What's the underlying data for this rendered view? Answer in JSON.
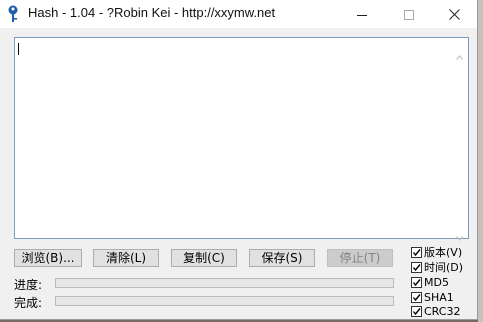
{
  "window": {
    "title": "Hash - 1.04 - ?Robin Kei - http://xxymw.net",
    "app_icon": "pin-key-icon",
    "controls": {
      "minimize_icon": "minimize-icon",
      "maximize_icon": "maximize-icon",
      "close_icon": "close-icon"
    }
  },
  "output": {
    "text": ""
  },
  "buttons": {
    "browse": "浏览(B)...",
    "clear": "清除(L)",
    "copy": "复制(C)",
    "save": "保存(S)",
    "stop": "停止(T)"
  },
  "progress": {
    "progress_label": "进度:",
    "progress_value": 0,
    "complete_label": "完成:",
    "complete_value": 0
  },
  "options": [
    {
      "label": "版本(V)",
      "checked": true
    },
    {
      "label": "时间(D)",
      "checked": true
    },
    {
      "label": "MD5",
      "checked": true
    },
    {
      "label": "SHA1",
      "checked": true
    },
    {
      "label": "CRC32",
      "checked": true
    }
  ],
  "colors": {
    "progress_fill": "#06b025",
    "textarea_border": "#7a9cbf"
  }
}
